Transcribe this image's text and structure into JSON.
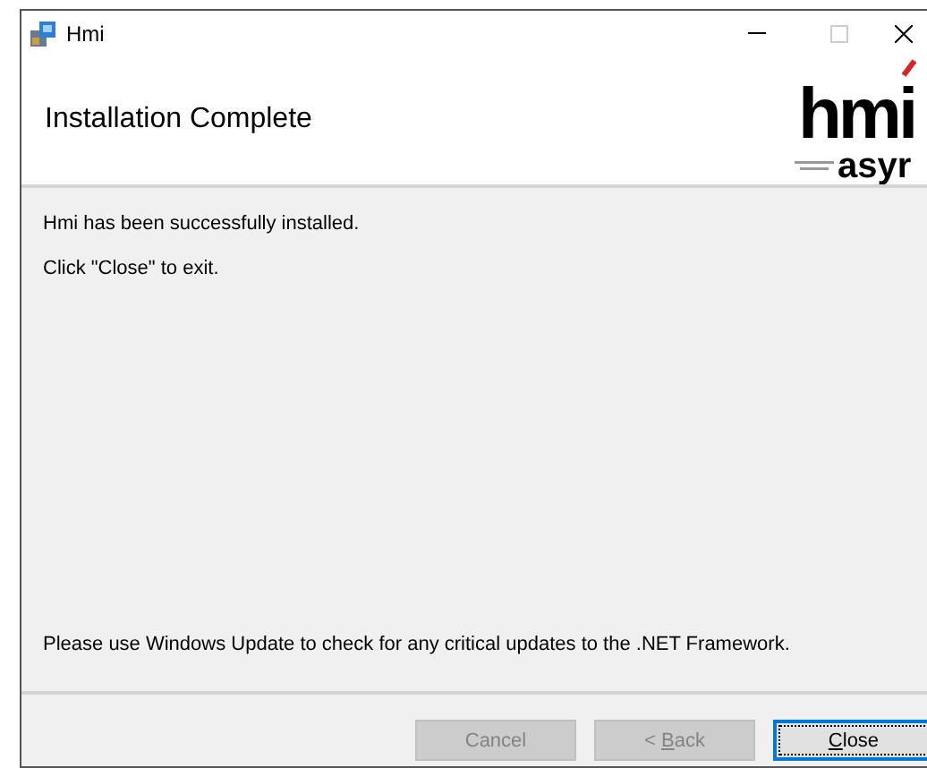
{
  "window": {
    "title": "Hmi"
  },
  "header": {
    "title": "Installation Complete",
    "logo": {
      "main": "hmi",
      "sub": "asyr"
    }
  },
  "messages": [
    "Hmi has been successfully installed.",
    "Click \"Close\" to exit."
  ],
  "footer_note": "Please use Windows Update to check for any critical updates to the .NET Framework.",
  "buttons": [
    {
      "text_before": "Cancel",
      "disabled": true,
      "default": false
    },
    {
      "text_before": "< ",
      "access_key": "B",
      "text_after": "ack",
      "disabled": true,
      "default": false
    },
    {
      "access_key": "C",
      "text_after": "lose",
      "disabled": false,
      "default": true
    }
  ]
}
